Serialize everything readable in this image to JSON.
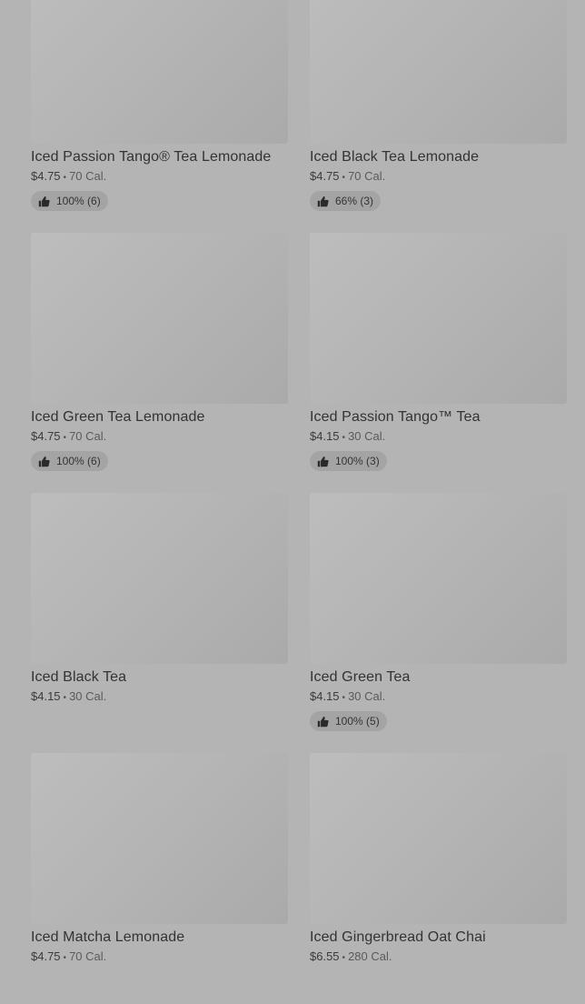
{
  "products": [
    {
      "name": "Iced Passion Tango® Tea Lemonade",
      "price": "$4.75",
      "calories": "70 Cal.",
      "rating": "100% (6)"
    },
    {
      "name": "Iced Black Tea Lemonade",
      "price": "$4.75",
      "calories": "70 Cal.",
      "rating": "66% (3)"
    },
    {
      "name": "Iced Green Tea Lemonade",
      "price": "$4.75",
      "calories": "70 Cal.",
      "rating": "100% (6)"
    },
    {
      "name": "Iced Passion Tango™ Tea",
      "price": "$4.15",
      "calories": "30 Cal.",
      "rating": "100% (3)"
    },
    {
      "name": "Iced Black Tea",
      "price": "$4.15",
      "calories": "30 Cal.",
      "rating": ""
    },
    {
      "name": "Iced Green Tea",
      "price": "$4.15",
      "calories": "30 Cal.",
      "rating": "100% (5)"
    },
    {
      "name": "Iced Matcha Lemonade",
      "price": "$4.75",
      "calories": "70 Cal.",
      "rating": ""
    },
    {
      "name": "Iced Gingerbread Oat Chai",
      "price": "$6.55",
      "calories": "280 Cal.",
      "rating": ""
    }
  ],
  "meta_separator": "•",
  "icons": {
    "rating": "thumbs-up-icon"
  },
  "colors": {
    "overlay": "#b4b4b4",
    "text": "#333333"
  }
}
